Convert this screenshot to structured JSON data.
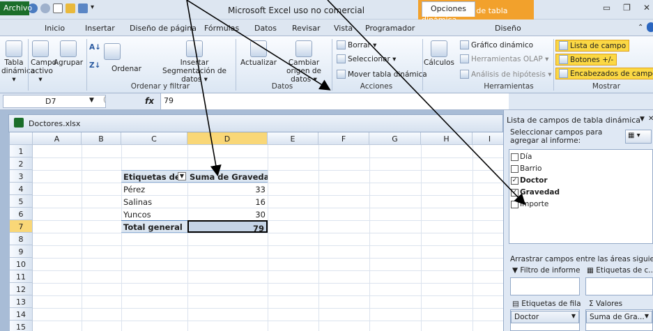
{
  "window": {
    "title": "Microsoft Excel uso no comercial",
    "context_header": "Herramientas de tabla dinámica"
  },
  "tabs": [
    "Archivo",
    "Inicio",
    "Insertar",
    "Diseño de página",
    "Fórmulas",
    "Datos",
    "Revisar",
    "Vista",
    "Programador",
    "Opciones",
    "Diseño"
  ],
  "ribbon": {
    "tabla_dinamica": "Tabla dinámica ▾",
    "campo_activo": "Campo activo ▾",
    "agrupar": "Agrupar",
    "ordenar": "Ordenar",
    "insertar_segmentacion": "Insertar Segmentación de datos ▾",
    "actualizar": "Actualizar",
    "cambiar_origen": "Cambiar origen de datos ▾",
    "borrar": "Borrar ▾",
    "seleccionar": "Seleccionar ▾",
    "mover": "Mover tabla dinámica",
    "calculos": "Cálculos",
    "grafico": "Gráfico dinámico",
    "olap": "Herramientas OLAP ▾",
    "hipotesis": "Análisis de hipótesis ▾",
    "lista_campo": "Lista de campo",
    "botones": "Botones +/-",
    "encabezados": "Encabezados de campo",
    "groups": {
      "ordenar_filtrar": "Ordenar y filtrar",
      "datos": "Datos",
      "acciones": "Acciones",
      "herramientas": "Herramientas",
      "mostrar": "Mostrar"
    }
  },
  "formula_bar": {
    "name_box": "D7",
    "fx": "fx",
    "value": "79"
  },
  "workbook": {
    "name": "Doctores.xlsx"
  },
  "sheet": {
    "columns": [
      "A",
      "B",
      "C",
      "D",
      "E",
      "F",
      "G",
      "H",
      "I"
    ],
    "rows": [
      "1",
      "2",
      "3",
      "4",
      "5",
      "6",
      "7",
      "8",
      "9",
      "10",
      "11",
      "12",
      "13",
      "14",
      "15"
    ],
    "pivot": {
      "row_label_header": "Etiquetas de f",
      "value_header": "Suma de Gravedad",
      "rows": [
        {
          "label": "Pérez",
          "value": "33"
        },
        {
          "label": "Salinas",
          "value": "16"
        },
        {
          "label": "Yuncos",
          "value": "30"
        }
      ],
      "total_label": "Total general",
      "total_value": "79"
    }
  },
  "field_panel": {
    "title": "Lista de campos de tabla dinámica",
    "instruction": "Seleccionar campos para agregar al informe:",
    "fields": [
      {
        "name": "Día",
        "checked": false
      },
      {
        "name": "Barrio",
        "checked": false
      },
      {
        "name": "Doctor",
        "checked": true
      },
      {
        "name": "Gravedad",
        "checked": true
      },
      {
        "name": "Importe",
        "checked": false
      }
    ],
    "drag_hint": "Arrastrar campos entre las áreas siguientes:",
    "filter_zone": "Filtro de informe",
    "column_zone": "Etiquetas de c...",
    "row_zone": "Etiquetas de fila",
    "values_zone": "Valores",
    "row_item": "Doctor",
    "value_item": "Suma de Gra..."
  }
}
